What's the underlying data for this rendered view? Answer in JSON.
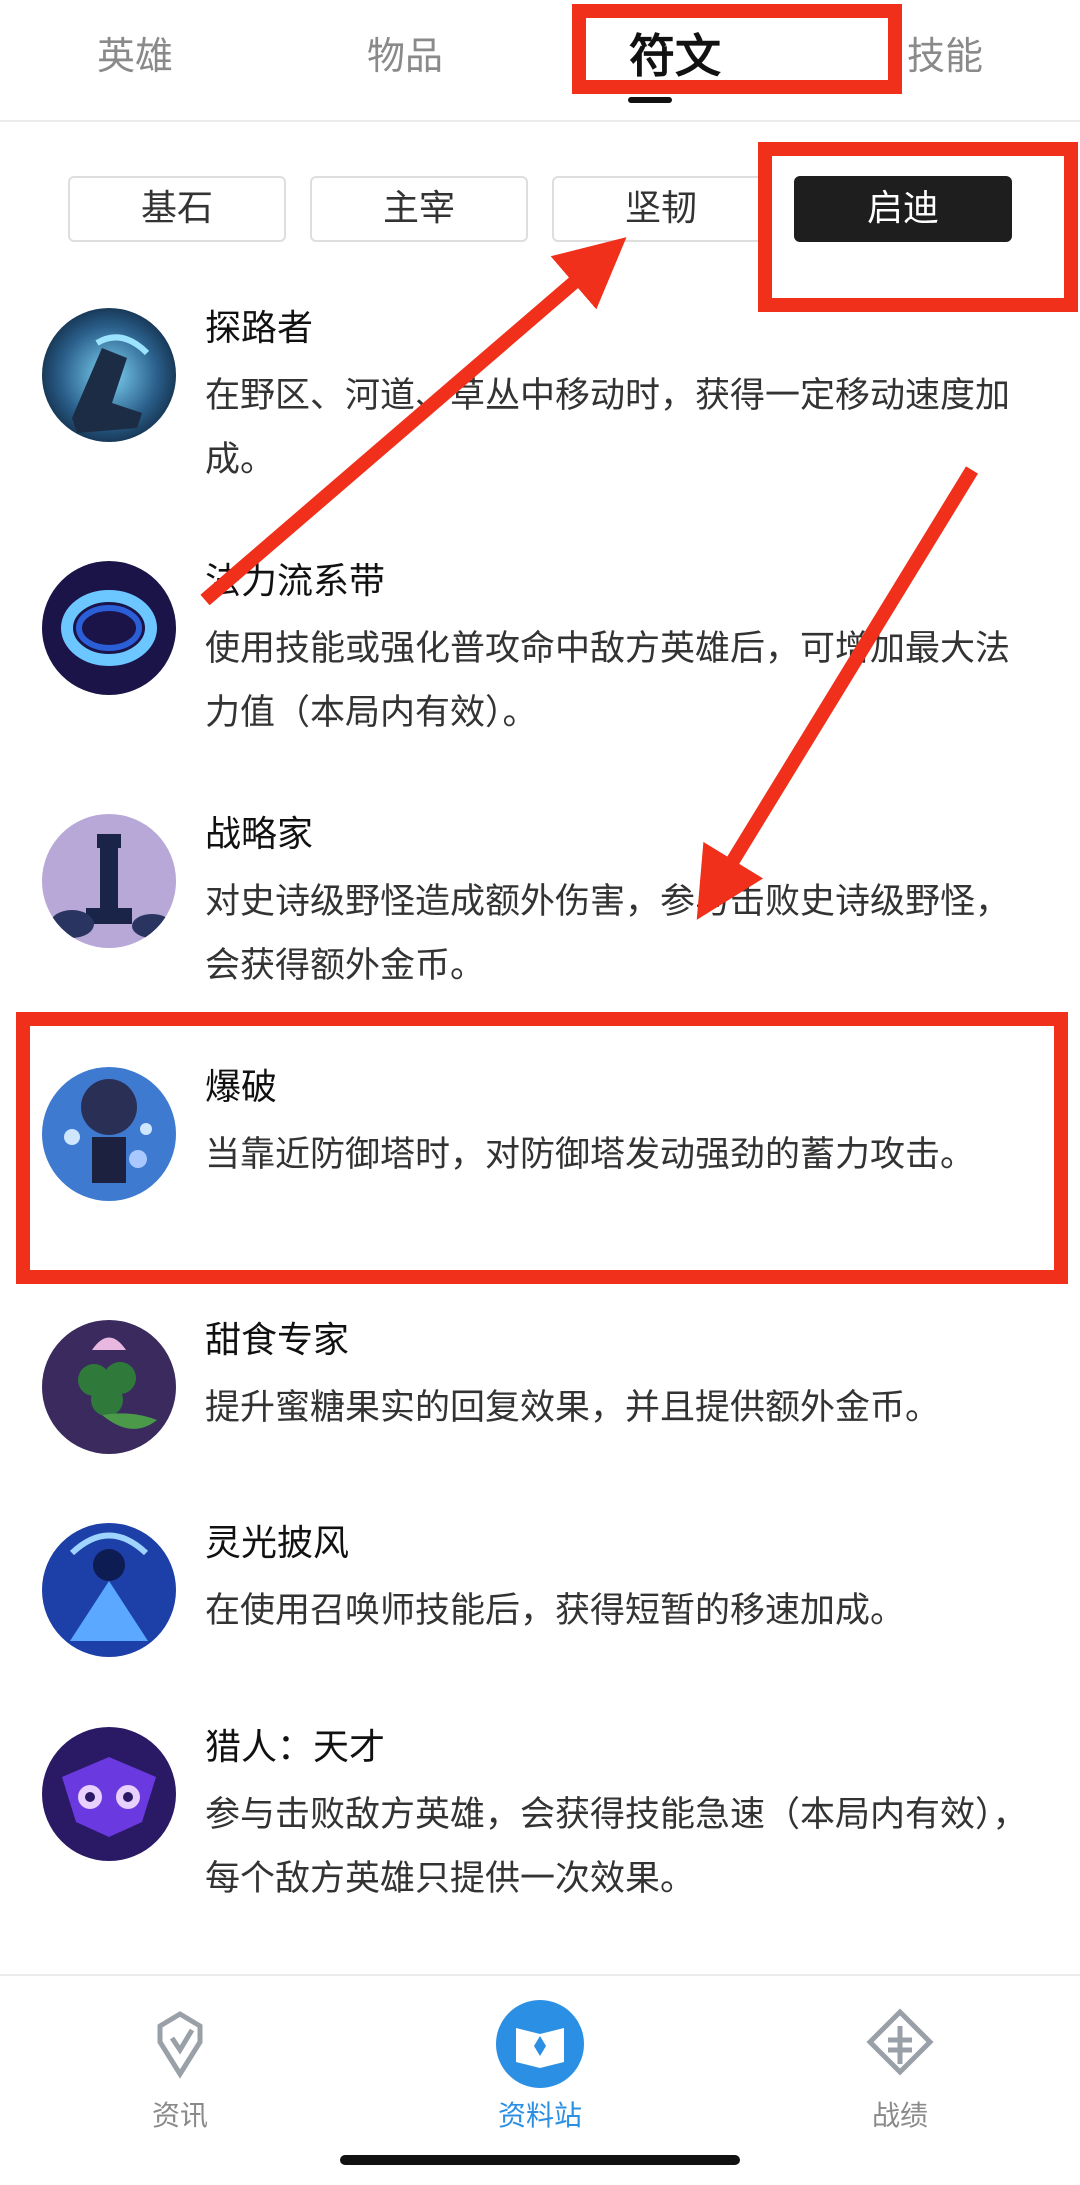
{
  "top_tabs": [
    {
      "label": "英雄"
    },
    {
      "label": "物品"
    },
    {
      "label": "符文",
      "active": true
    },
    {
      "label": "技能"
    }
  ],
  "sub_tabs": [
    {
      "label": "基石"
    },
    {
      "label": "主宰"
    },
    {
      "label": "坚韧"
    },
    {
      "label": "启迪",
      "active": true
    }
  ],
  "runes": [
    {
      "name": "探路者",
      "desc": "在野区、河道、草丛中移动时，获得一定移动速度加成。",
      "icon": "pathfinder-rune-icon"
    },
    {
      "name": "法力流系带",
      "desc": "使用技能或强化普攻命中敌方英雄后，可增加最大法力值（本局内有效）。",
      "icon": "mana-flow-band-icon"
    },
    {
      "name": "战略家",
      "desc": "对史诗级野怪造成额外伤害，参与击败史诗级野怪，会获得额外金币。",
      "icon": "strategist-rune-icon"
    },
    {
      "name": "爆破",
      "desc": "当靠近防御塔时，对防御塔发动强劲的蓄力攻击。",
      "icon": "demolish-rune-icon"
    },
    {
      "name": "甜食专家",
      "desc": "提升蜜糖果实的回复效果，并且提供额外金币。",
      "icon": "sweet-tooth-rune-icon"
    },
    {
      "name": "灵光披风",
      "desc": "在使用召唤师技能后，获得短暂的移速加成。",
      "icon": "nimbus-cloak-rune-icon"
    },
    {
      "name": "猎人：天才",
      "desc": "参与击败敌方英雄，会获得技能急速（本局内有效），每个敌方英雄只提供一次效果。",
      "icon": "ultimate-hunter-rune-icon"
    }
  ],
  "bottom_nav": [
    {
      "label": "资讯",
      "icon": "news-icon"
    },
    {
      "label": "资料站",
      "icon": "database-book-icon",
      "active": true
    },
    {
      "label": "战绩",
      "icon": "records-icon"
    }
  ],
  "colors": {
    "accent_blue": "#2b8fe3",
    "annotation_red": "#f0301a",
    "active_tab_bg": "#1e1e1e"
  }
}
